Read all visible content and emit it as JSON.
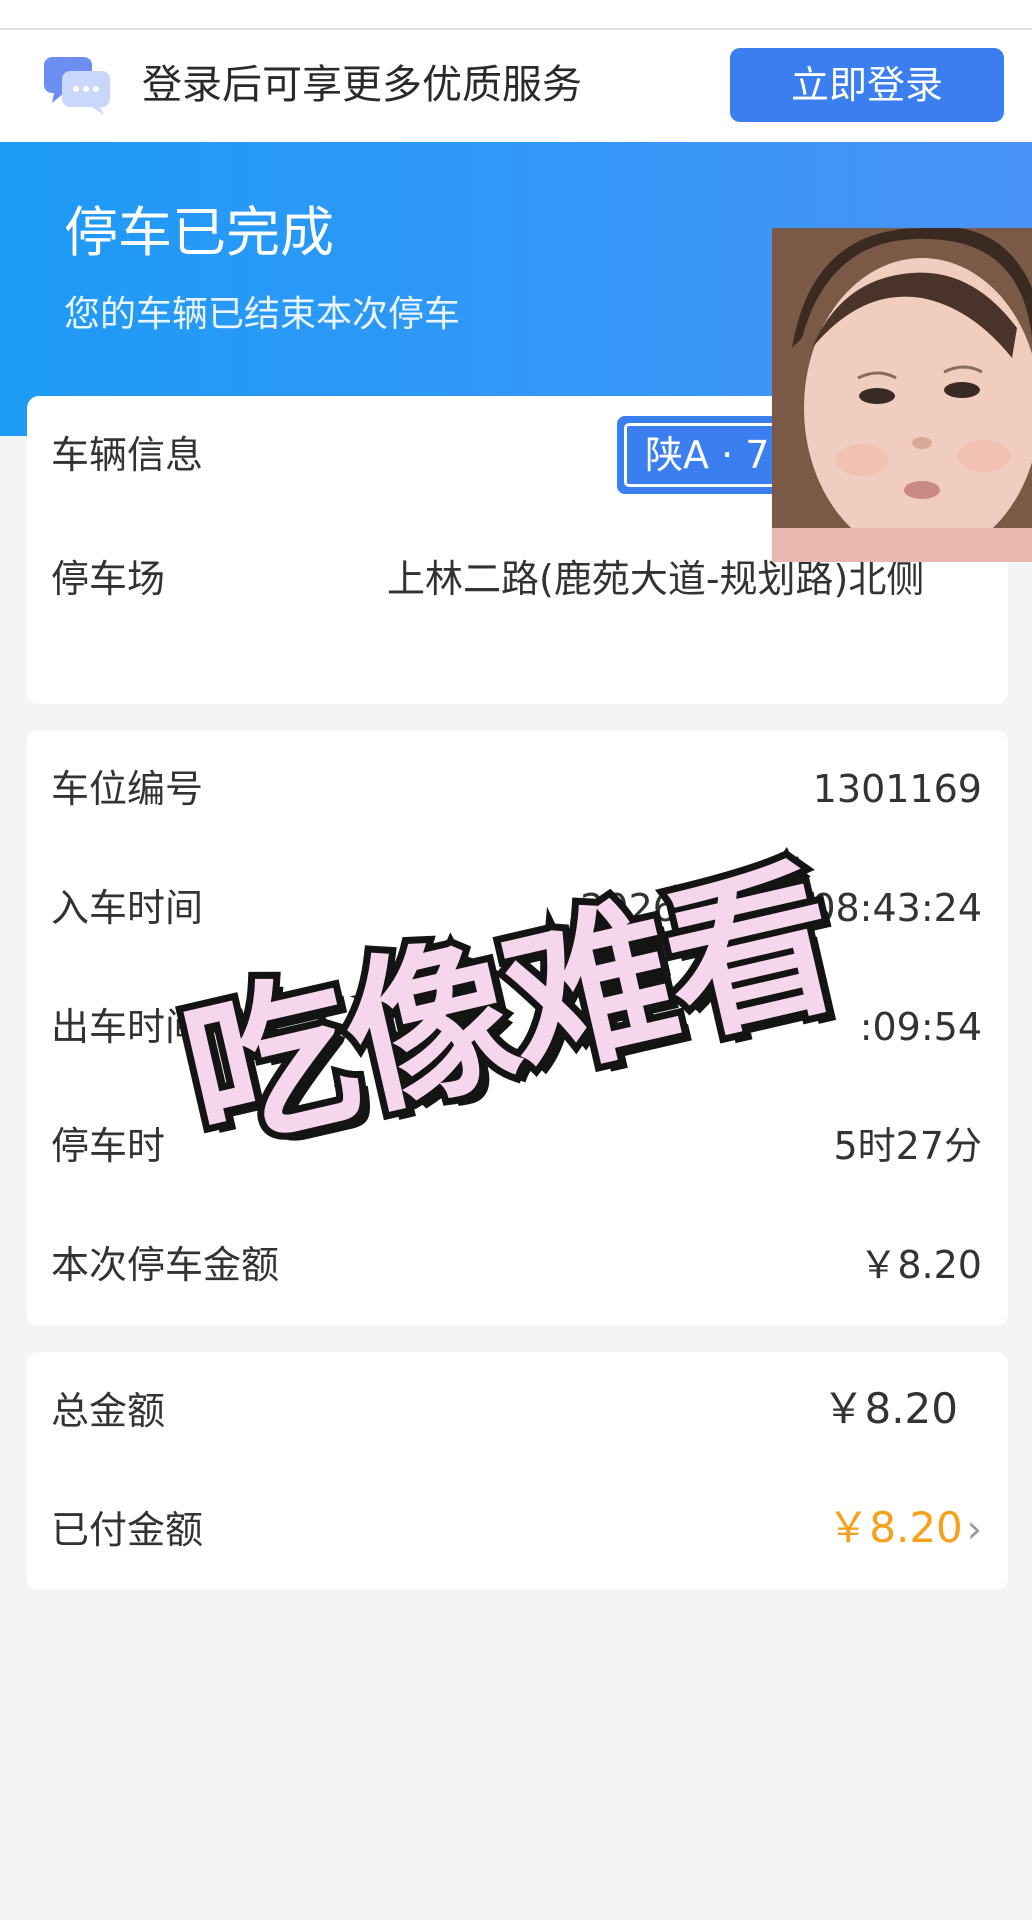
{
  "login_bar": {
    "prompt": "登录后可享更多优质服务",
    "button": "立即登录",
    "icon": "chat-bubble-icon"
  },
  "banner": {
    "title": "停车已完成",
    "subtitle": "您的车辆已结束本次停车"
  },
  "vehicle_card": {
    "vehicle_label": "车辆信息",
    "plate": "陕A · 7",
    "lot_label": "停车场",
    "lot_value": "上林二路(鹿苑大道-规划路)北侧"
  },
  "detail_card": {
    "rows": [
      {
        "label": "车位编号",
        "value": "1301169"
      },
      {
        "label": "入车时间",
        "value": "2026/06/08 08:43:24"
      },
      {
        "label": "出车时间",
        "value": ":09:54"
      },
      {
        "label": "停车时",
        "value": "5时27分"
      },
      {
        "label": "本次停车金额",
        "value": "￥8.20"
      }
    ]
  },
  "total_card": {
    "total_label": "总金额",
    "total_value": "￥8.20",
    "paid_label": "已付金额",
    "paid_value": "￥8.20",
    "chevron": "›"
  },
  "overlay": {
    "sticker_text": "吃像难看"
  },
  "colors": {
    "accent": "#3a7ef0",
    "banner": "#1d9bf5",
    "paid": "#f5a11c",
    "sticker_fill": "#f6d6ec"
  }
}
